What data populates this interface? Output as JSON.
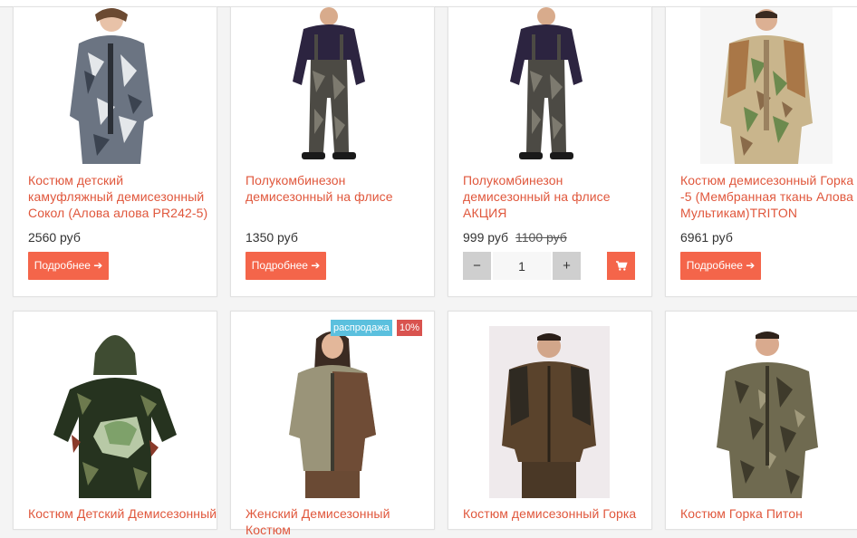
{
  "products": [
    {
      "title": "Костюм детский камуфляжный демисезонный Сокол (Алова алова PR242-5)",
      "price": "2560 руб",
      "button": "Подробнее ➔"
    },
    {
      "title": "Полукомбинезон демисезонный на флисе",
      "price": "1350 руб",
      "button": "Подробнее ➔"
    },
    {
      "title": "Полукомбинезон демисезонный на флисе АКЦИЯ",
      "price": "999 руб",
      "old_price": "1100 руб",
      "qty": "1",
      "minus": "−",
      "plus": "+"
    },
    {
      "title": "Костюм демисезонный Горка -5 (Мембранная ткань Алова Мультикам)TRITON",
      "price": "6961 руб",
      "button": "Подробнее ➔"
    },
    {
      "title": "Костюм Детский Демисезонный"
    },
    {
      "title": "Женский Демисезонный Костюм",
      "badge_sale": "распродажа",
      "badge_discount": "10%"
    },
    {
      "title": "Костюм демисезонный Горка"
    },
    {
      "title": "Костюм Горка Питон"
    }
  ],
  "icons": {
    "cart": "cart-icon",
    "arrow": "arrow-right-icon"
  },
  "colors": {
    "accent": "#f4654a",
    "title": "#e0573c",
    "sale_badge": "#5bc0de",
    "discount_badge": "#d9534f"
  }
}
